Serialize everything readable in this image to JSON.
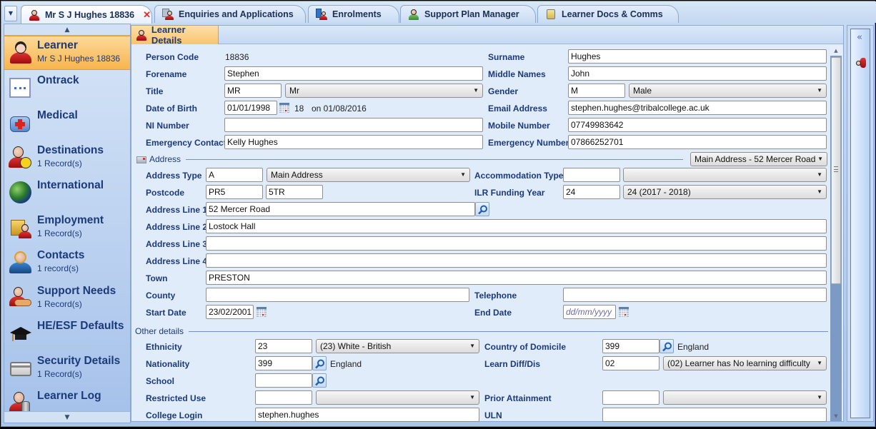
{
  "tabs": [
    {
      "label": "Mr S J Hughes 18836",
      "icon": "learner-person-icon",
      "active": true,
      "closable": true
    },
    {
      "label": "Enquiries and Applications",
      "icon": "enquiries-icon"
    },
    {
      "label": "Enrolments",
      "icon": "enrolments-icon"
    },
    {
      "label": "Support Plan Manager",
      "icon": "support-plan-icon"
    },
    {
      "label": "Learner Docs & Comms",
      "icon": "documents-icon"
    }
  ],
  "tab_menu_glyph": "▼",
  "tab_close_glyph": "✕",
  "sidebar": {
    "scroll_up": "▲",
    "scroll_down": "▼",
    "items": [
      {
        "label": "Learner",
        "sub": "Mr S J Hughes 18836",
        "icon": "learner-icon",
        "active": true
      },
      {
        "label": "Ontrack",
        "sub": "",
        "icon": "ontrack-icon"
      },
      {
        "label": "Medical",
        "sub": "",
        "icon": "medical-bag-icon"
      },
      {
        "label": "Destinations",
        "sub": "1 Record(s)",
        "icon": "destinations-icon"
      },
      {
        "label": "International",
        "sub": "",
        "icon": "globe-icon"
      },
      {
        "label": "Employment",
        "sub": "1 Record(s)",
        "icon": "employment-icon"
      },
      {
        "label": "Contacts",
        "sub": "1 record(s)",
        "icon": "contacts-icon"
      },
      {
        "label": "Support Needs",
        "sub": "1 Record(s)",
        "icon": "support-needs-icon"
      },
      {
        "label": "HE/ESF Defaults",
        "sub": "",
        "icon": "graduation-cap-icon"
      },
      {
        "label": "Security Details",
        "sub": "1 Record(s)",
        "icon": "security-card-icon"
      },
      {
        "label": "Learner Log",
        "sub": "",
        "icon": "learner-log-icon"
      }
    ]
  },
  "panel": {
    "title": "Learner Details"
  },
  "form": {
    "person_code_label": "Person Code",
    "person_code": "18836",
    "forename_label": "Forename",
    "forename": "Stephen",
    "title_label": "Title",
    "title_code": "MR",
    "title_select": "Mr",
    "dob_label": "Date of Birth",
    "dob": "01/01/1998",
    "age": "18",
    "age_on": "on 01/08/2016",
    "ni_label": "NI Number",
    "ni": "",
    "emergency_contact_label": "Emergency Contact",
    "emergency_contact": "Kelly Hughes",
    "surname_label": "Surname",
    "surname": "Hughes",
    "middle_names_label": "Middle Names",
    "middle_names": "John",
    "gender_label": "Gender",
    "gender_code": "M",
    "gender_select": "Male",
    "email_label": "Email Address",
    "email": "stephen.hughes@tribalcollege.ac.uk",
    "mobile_label": "Mobile Number",
    "mobile": "07749983642",
    "emergency_number_label": "Emergency Number",
    "emergency_number": "07866252701"
  },
  "address": {
    "section_label": "Address",
    "address_selector": "Main Address - 52 Mercer Road",
    "type_label": "Address Type",
    "type_code": "A",
    "type_select": "Main Address",
    "postcode_label": "Postcode",
    "postcode_out": "PR5",
    "postcode_in": "5TR",
    "line1_label": "Address Line 1",
    "line1": "52 Mercer Road",
    "line2_label": "Address Line 2",
    "line2": "Lostock Hall",
    "line3_label": "Address Line 3",
    "line3": "",
    "line4_label": "Address Line 4",
    "line4": "",
    "town_label": "Town",
    "town": "PRESTON",
    "county_label": "County",
    "county": "",
    "start_date_label": "Start Date",
    "start_date": "23/02/2001",
    "accommodation_label": "Accommodation Type",
    "accommodation_code": "",
    "accommodation_select": "",
    "ilr_label": "ILR Funding Year",
    "ilr_code": "24",
    "ilr_select": "24 (2017 - 2018)",
    "telephone_label": "Telephone",
    "telephone": "",
    "end_date_label": "End Date",
    "end_date_placeholder": "dd/mm/yyyy"
  },
  "other": {
    "section_label": "Other details",
    "ethnicity_label": "Ethnicity",
    "ethnicity_code": "23",
    "ethnicity_select": "(23) White - British",
    "nationality_label": "Nationality",
    "nationality_code": "399",
    "nationality_name": "England",
    "school_label": "School",
    "school_code": "",
    "restricted_label": "Restricted Use",
    "restricted_code": "",
    "restricted_select": "",
    "college_login_label": "College Login",
    "college_login": "stephen.hughes",
    "domicile_label": "Country of Domicile",
    "domicile_code": "399",
    "domicile_name": "England",
    "ldd_label": "Learn Diff/Dis",
    "ldd_code": "02",
    "ldd_select": "(02) Learner has No learning difficulty",
    "prior_label": "Prior Attainment",
    "prior_code": "",
    "prior_select": "",
    "uln_label": "ULN",
    "uln": ""
  },
  "right_panel": {
    "collapse_glyph": "«"
  },
  "scrollbar": {
    "up": "▲",
    "down": "▼",
    "position_fraction": 0.0
  },
  "colors": {
    "accent_orange": "#f7b54d",
    "label_blue": "#1c3a7a",
    "panel_bg": "#e1ecfb"
  }
}
